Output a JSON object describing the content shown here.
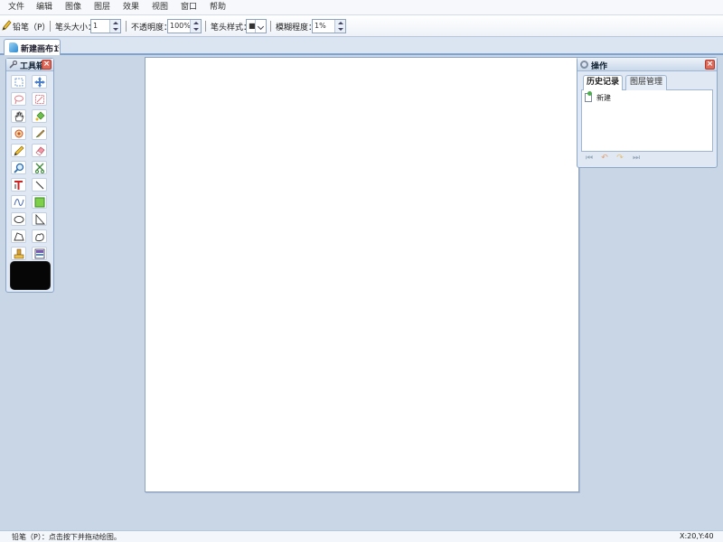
{
  "menu": [
    "文件",
    "编辑",
    "图像",
    "图层",
    "效果",
    "视图",
    "窗口",
    "帮助"
  ],
  "options": {
    "tool_name": "铅笔（P）",
    "brush_size_label": "笔头大小：",
    "brush_size_value": "1",
    "opacity_label": "不透明度：",
    "opacity_value": "100%",
    "brush_style_label": "笔头样式：",
    "brush_style_value": "■",
    "blur_label": "模糊程度：",
    "blur_value": "1%"
  },
  "document_tab": {
    "title": "新建画布1",
    "close": "×"
  },
  "toolbox": {
    "title": "工具箱",
    "close": "×",
    "foreground_color": "#060606"
  },
  "ops_panel": {
    "title": "操作",
    "close": "×",
    "tabs": [
      {
        "label": "历史记录",
        "active": true
      },
      {
        "label": "图层管理",
        "active": false
      }
    ],
    "history": [
      "新建"
    ],
    "nav": [
      "⏮",
      "↶",
      "↷",
      "⏭"
    ]
  },
  "status": {
    "hint": "铅笔（P）：点击按下并拖动绘图。",
    "coords": "X:20,Y:40"
  },
  "colors": {
    "accent": "#7fa2cf",
    "panel_bg": "#dfe8f3",
    "workspace": "#c9d6e6"
  }
}
